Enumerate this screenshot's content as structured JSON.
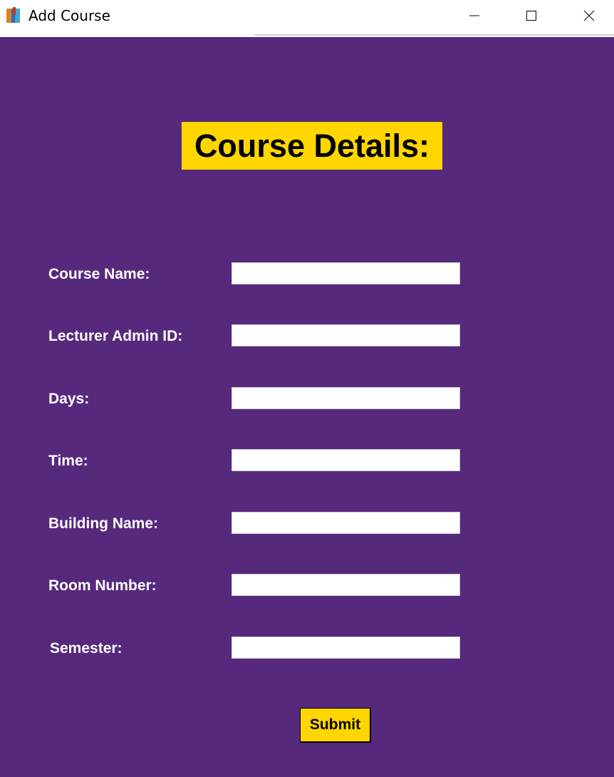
{
  "window": {
    "title": "Add Course",
    "app_icon": "books-icon",
    "controls": [
      "minimize-icon",
      "maximize-icon",
      "close-icon"
    ]
  },
  "form": {
    "heading": "Course Details:",
    "fields": [
      {
        "label": "Course Name:",
        "value": ""
      },
      {
        "label": "Lecturer Admin ID:",
        "value": ""
      },
      {
        "label": "Days:",
        "value": ""
      },
      {
        "label": "Time:",
        "value": ""
      },
      {
        "label": "Building Name:",
        "value": ""
      },
      {
        "label": "Room Number:",
        "value": ""
      },
      {
        "label": "Semester:",
        "value": ""
      }
    ],
    "submit_label": "Submit"
  },
  "colors": {
    "background": "#57297d",
    "heading_background": "#ffd600",
    "button_background": "#ffd600",
    "label_text": "#ffffff"
  }
}
